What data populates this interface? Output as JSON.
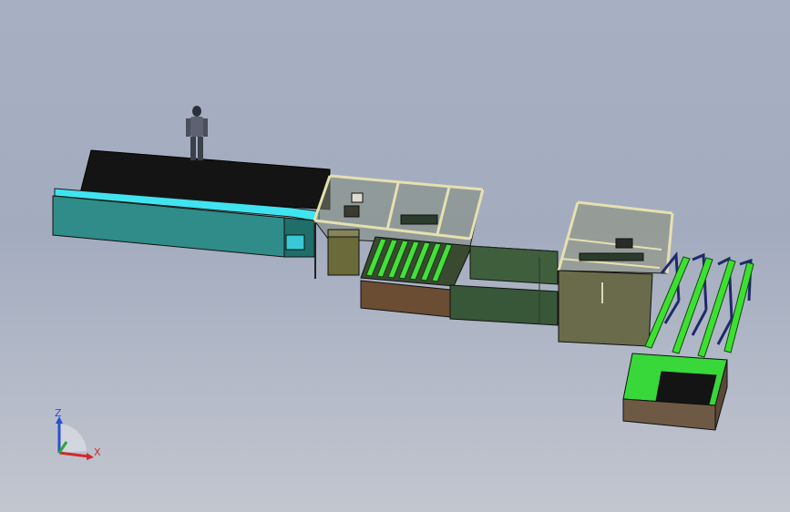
{
  "view": {
    "background_top": "#a7b0c2",
    "background_bottom": "#c2c6cf"
  },
  "triad": {
    "z_label": "Z",
    "x_label": "X",
    "z_color": "#2a4fd0",
    "x_color": "#d02a2a",
    "y_color": "#2aa83a"
  },
  "colors": {
    "teal_body": "#2f8f8a",
    "cyan_stripe": "#3fe4f0",
    "black_top": "#151515",
    "olive_frame": "#6b6a3a",
    "dark_green": "#3c5a3a",
    "bright_green": "#38d83a",
    "brown_box": "#6e5a44",
    "navy_rack": "#1f2a6a"
  }
}
